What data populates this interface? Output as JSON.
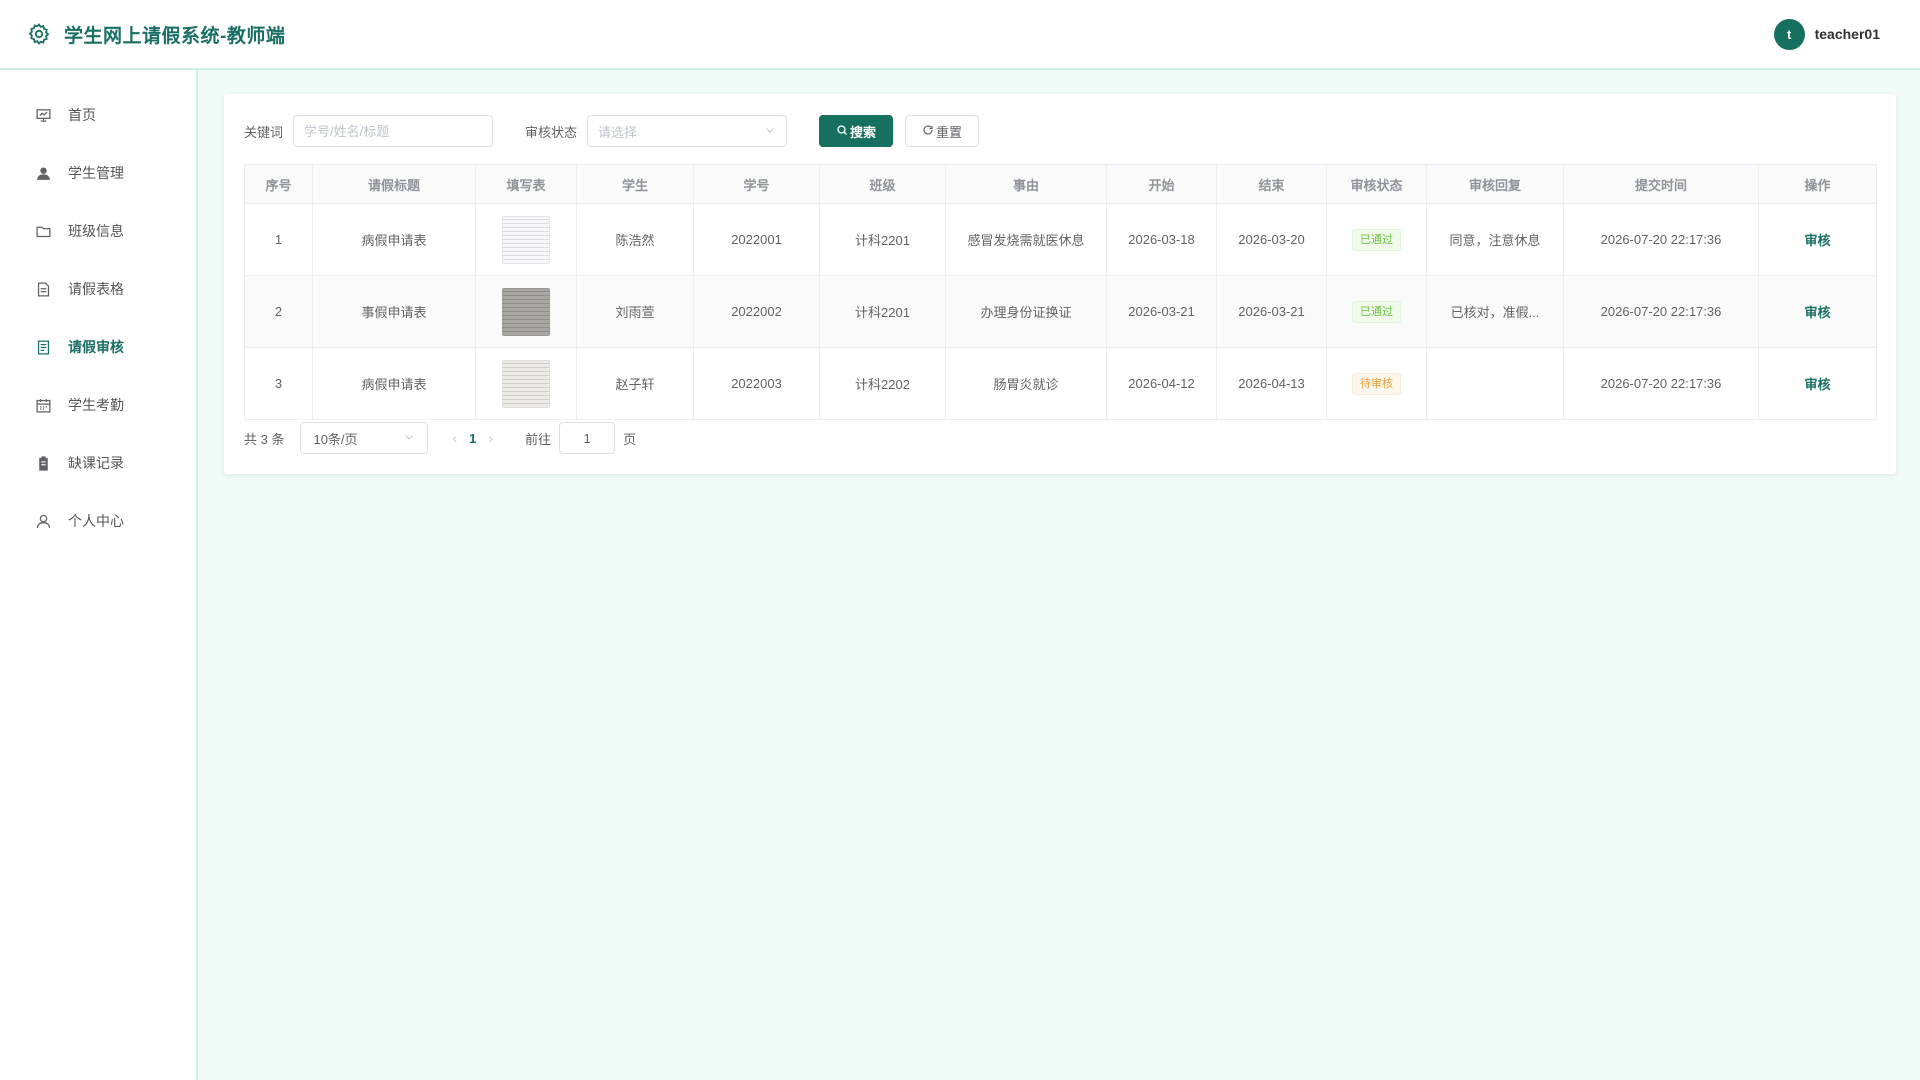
{
  "header": {
    "title": "学生网上请假系统-教师端",
    "avatar_letter": "t",
    "username": "teacher01"
  },
  "sidebar": {
    "items": [
      {
        "label": "首页",
        "icon": "presentation-chart-icon"
      },
      {
        "label": "学生管理",
        "icon": "user-filled-icon"
      },
      {
        "label": "班级信息",
        "icon": "folder-icon"
      },
      {
        "label": "请假表格",
        "icon": "document-icon"
      },
      {
        "label": "请假审核",
        "icon": "document-check-icon",
        "active": true
      },
      {
        "label": "学生考勤",
        "icon": "calendar-icon"
      },
      {
        "label": "缺课记录",
        "icon": "clipboard-icon"
      },
      {
        "label": "个人中心",
        "icon": "user-icon"
      }
    ]
  },
  "filters": {
    "keyword_label": "关键词",
    "keyword_placeholder": "学号/姓名/标题",
    "status_label": "审核状态",
    "status_placeholder": "请选择",
    "search_label": "搜索",
    "reset_label": "重置"
  },
  "table": {
    "columns": [
      "序号",
      "请假标题",
      "填写表",
      "学生",
      "学号",
      "班级",
      "事由",
      "开始",
      "结束",
      "审核状态",
      "审核回复",
      "提交时间",
      "操作"
    ],
    "rows": [
      {
        "index": "1",
        "title": "病假申请表",
        "student": "陈浩然",
        "student_id": "2022001",
        "class": "计科2201",
        "reason": "感冒发烧需就医休息",
        "start": "2026-03-18",
        "end": "2026-03-20",
        "status": "已通过",
        "status_type": "success",
        "reply": "同意，注意休息",
        "submitted": "2026-07-20 22:17:36",
        "action": "审核"
      },
      {
        "index": "2",
        "title": "事假申请表",
        "student": "刘雨萱",
        "student_id": "2022002",
        "class": "计科2201",
        "reason": "办理身份证换证",
        "start": "2026-03-21",
        "end": "2026-03-21",
        "status": "已通过",
        "status_type": "success",
        "reply": "已核对，准假...",
        "submitted": "2026-07-20 22:17:36",
        "action": "审核"
      },
      {
        "index": "3",
        "title": "病假申请表",
        "student": "赵子轩",
        "student_id": "2022003",
        "class": "计科2202",
        "reason": "肠胃炎就诊",
        "start": "2026-04-12",
        "end": "2026-04-13",
        "status": "待审核",
        "status_type": "warning",
        "reply": "",
        "submitted": "2026-07-20 22:17:36",
        "action": "审核"
      }
    ]
  },
  "pagination": {
    "total_text": "共 3 条",
    "page_size": "10条/页",
    "current_page": "1",
    "goto_label": "前往",
    "goto_value": "1",
    "page_suffix": "页"
  },
  "colors": {
    "brand": "#1a6f64",
    "primary_button": "#16705f",
    "background": "#f0faf7",
    "success": "#67c23a",
    "warning": "#e6a23c"
  }
}
